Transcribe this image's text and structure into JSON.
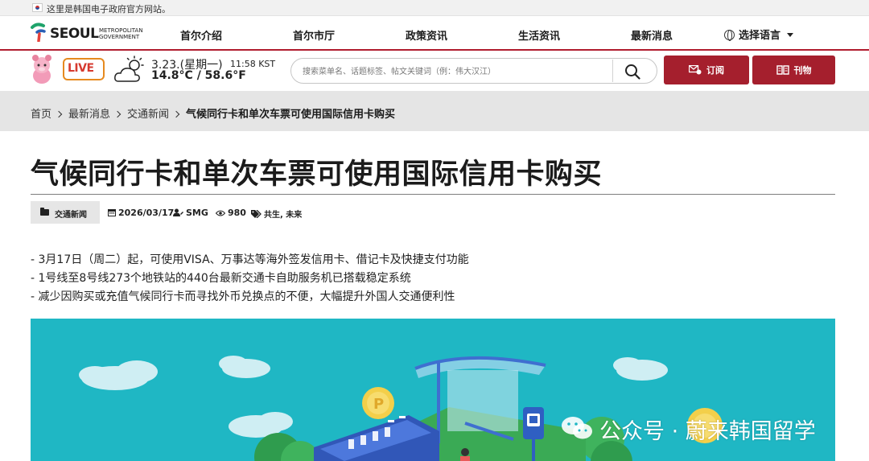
{
  "notice": {
    "text": "这里是韩国电子政府官方网站。"
  },
  "logo": {
    "name": "SEOUL",
    "sub_line1": "METROPOLITAN",
    "sub_line2": "GOVERNMENT"
  },
  "nav": {
    "items": [
      "首尔介绍",
      "首尔市厅",
      "政策资讯",
      "生活资讯",
      "最新消息"
    ],
    "language_label": "选择语言"
  },
  "utility": {
    "live_label": "LIVE",
    "weather": {
      "date": "3.23.(星期一)",
      "time": "11:58 KST",
      "temp": "14.8°C / 58.6°F"
    },
    "search": {
      "placeholder": "搜索菜单名、话题标签、帖文关键词（例：伟大汉江）"
    },
    "subscribe_label": "订阅",
    "publication_label": "刊物"
  },
  "breadcrumb": {
    "items": [
      "首页",
      "最新消息",
      "交通新闻"
    ],
    "current": "气候同行卡和单次车票可使用国际信用卡购买"
  },
  "article": {
    "title": "气候同行卡和单次车票可使用国际信用卡购买",
    "category": "交通新闻",
    "date": "2026/03/17",
    "author": "SMG",
    "views": "980",
    "tags": "共生, 未来",
    "summary": [
      "- 3月17日（周二）起，可使用VISA、万事达等海外签发信用卡、借记卡及快捷支付功能",
      "- 1号线至8号线273个地铁站的440台最新交通卡自助服务机已搭载稳定系统",
      "- 减少因购买或充值气候同行卡而寻找外币兑换点的不便，大幅提升外国人交通便利性"
    ]
  },
  "watermark": {
    "text": "公众号 · 蔚来韩国留学"
  },
  "colors": {
    "brand_red": "#a51f2d",
    "hero_teal": "#1fb7c4",
    "breadcrumb_bg": "#e5e5e5"
  }
}
